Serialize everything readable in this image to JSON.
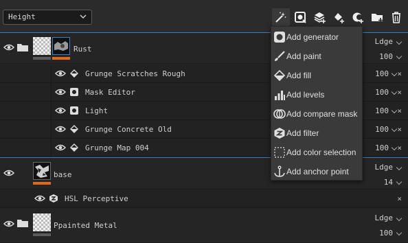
{
  "toolbar": {
    "channel_select": "Height",
    "icons": [
      "magic-wand-icon",
      "add-layer-circle-icon",
      "add-layer-stack-icon",
      "fill-bucket-icon",
      "mask-icon",
      "new-folder-icon",
      "trash-icon"
    ]
  },
  "layers": {
    "rust": {
      "name": "Rust",
      "blend": "Ldge",
      "opacity": "100"
    },
    "rust_children": [
      {
        "name": "Grunge Scratches Rough",
        "opacity": "100",
        "close": "×"
      },
      {
        "name": "Mask Editor",
        "opacity": "100",
        "close": "×"
      },
      {
        "name": "Light",
        "opacity": "100",
        "close": "×"
      },
      {
        "name": "Grunge Concrete Old",
        "opacity": "100",
        "close": "×"
      },
      {
        "name": "Grunge Map 004",
        "opacity": "100",
        "close": "×"
      }
    ],
    "base": {
      "name": "base",
      "blend": "Ldge",
      "opacity": "14"
    },
    "base_children": [
      {
        "name": "HSL Perceptive",
        "close": "×"
      }
    ],
    "painted_metal": {
      "name": "Ppainted Metal",
      "blend": "Ldge",
      "opacity": "100"
    }
  },
  "menu": {
    "items": [
      {
        "label": "Add generator",
        "icon": "generator-icon"
      },
      {
        "label": "Add paint",
        "icon": "brush-icon"
      },
      {
        "label": "Add fill",
        "icon": "fill-icon"
      },
      {
        "label": "Add levels",
        "icon": "levels-icon"
      },
      {
        "label": "Add compare mask",
        "icon": "compare-mask-icon"
      },
      {
        "label": "Add filter",
        "icon": "filter-icon"
      },
      {
        "label": "Add color selection",
        "icon": "color-selection-icon"
      },
      {
        "label": "Add anchor point",
        "icon": "anchor-icon"
      }
    ]
  },
  "colors": {
    "accent": "#3d7fc0",
    "orange": "#e06a1c"
  }
}
